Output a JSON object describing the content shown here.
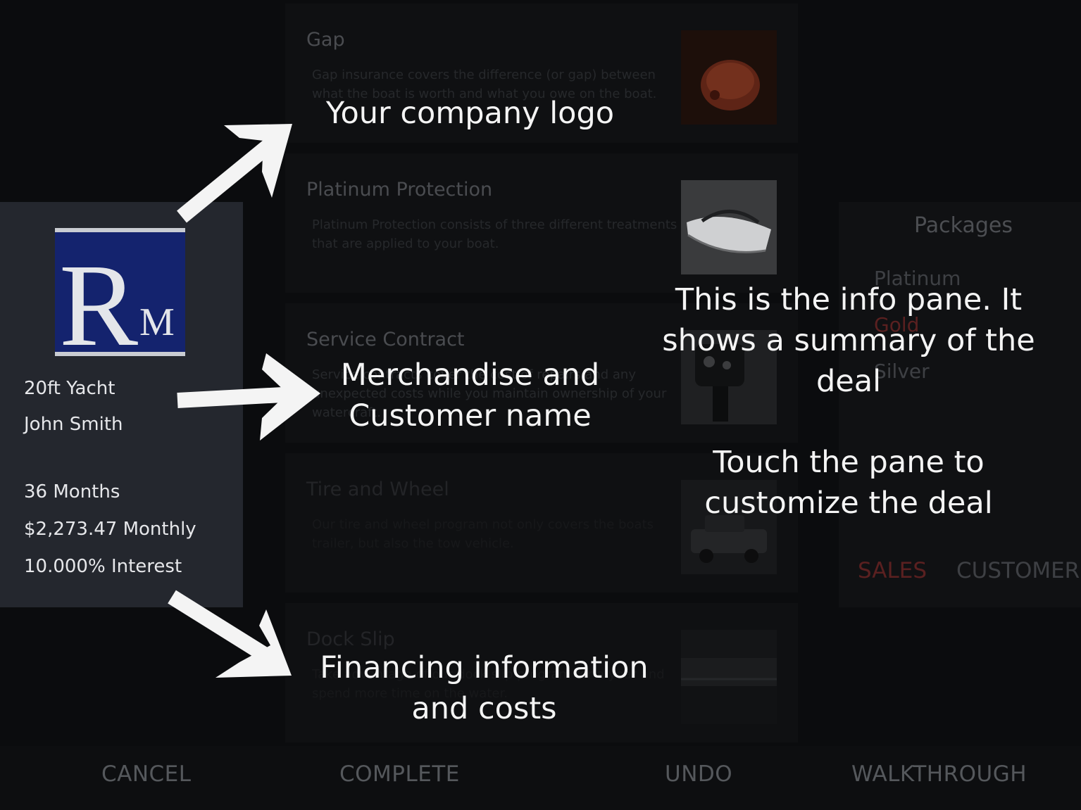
{
  "products": [
    {
      "title": "Gap",
      "description": "Gap insurance covers the difference (or gap) between what the boat is worth and what you owe on the boat.",
      "image_icon": "piggy-bank-image"
    },
    {
      "title": "Platinum Protection",
      "description": "Platinum Protection consists of three different treatments that are applied to your boat.",
      "image_icon": "boat-image"
    },
    {
      "title": "Service Contract",
      "description": "Service contracts cover the cost of repairs and any unexpected costs while you maintain ownership of your watercraft.",
      "image_icon": "outboard-motor-image"
    },
    {
      "title": "Tire and Wheel",
      "description": "Our tire and wheel program not only covers the boats trailer, but also the tow vehicle.",
      "image_icon": "truck-image"
    },
    {
      "title": "Dock Slip",
      "description": "Take advantage of our dock slip program for a year and spend more time on the water.",
      "image_icon": "marina-image"
    }
  ],
  "info_pane": {
    "logo_text": {
      "big": "R",
      "small": "M"
    },
    "merchandise": "20ft Yacht",
    "customer": "John Smith",
    "term": "36 Months",
    "payment": "$2,273.47 Monthly",
    "interest": "10.000% Interest"
  },
  "packages": {
    "title": "Packages",
    "items": [
      "Platinum",
      "Gold",
      "Silver"
    ],
    "tabs": {
      "sales": "SALES",
      "customer": "CUSTOMER"
    }
  },
  "bottom_bar": {
    "cancel": "CANCEL",
    "complete": "COMPLETE",
    "undo": "UNDO",
    "walkthrough": "WALKTHROUGH"
  },
  "annotations": {
    "logo": "Your company logo",
    "merch_1": "Merchandise and",
    "merch_2": "Customer name",
    "fin_1": "Financing information",
    "fin_2": "and costs",
    "pane_1": "This is the info pane. It",
    "pane_2": "shows a summary of the",
    "pane_3": "deal",
    "touch_1": "Touch the pane to",
    "touch_2": "customize the deal"
  },
  "colors": {
    "accent_red": "#5a2020",
    "info_pane_bg": "#24272e",
    "logo_blue": "#14236e"
  }
}
